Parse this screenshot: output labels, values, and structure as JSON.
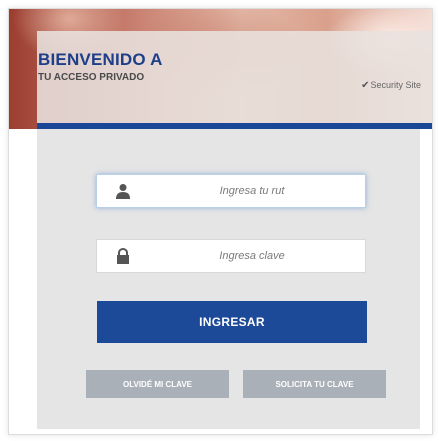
{
  "header": {
    "title": "BIENVENIDO A",
    "subtitle": "TU ACCESO PRIVADO",
    "security_check": "✔",
    "security_label": "Security Site"
  },
  "form": {
    "rut": {
      "icon": "user-icon",
      "placeholder": "Ingresa tu rut"
    },
    "clave": {
      "icon": "lock-icon",
      "placeholder": "Ingresa clave"
    },
    "submit_label": "INGRESAR",
    "forgot_label": "OLVIDÉ MI CLAVE",
    "request_label": "SOLICITA TU CLAVE"
  },
  "colors": {
    "brand_blue": "#1c4a98",
    "secondary_button": "#a9b0b8",
    "panel_bg": "#e5e5e5"
  }
}
